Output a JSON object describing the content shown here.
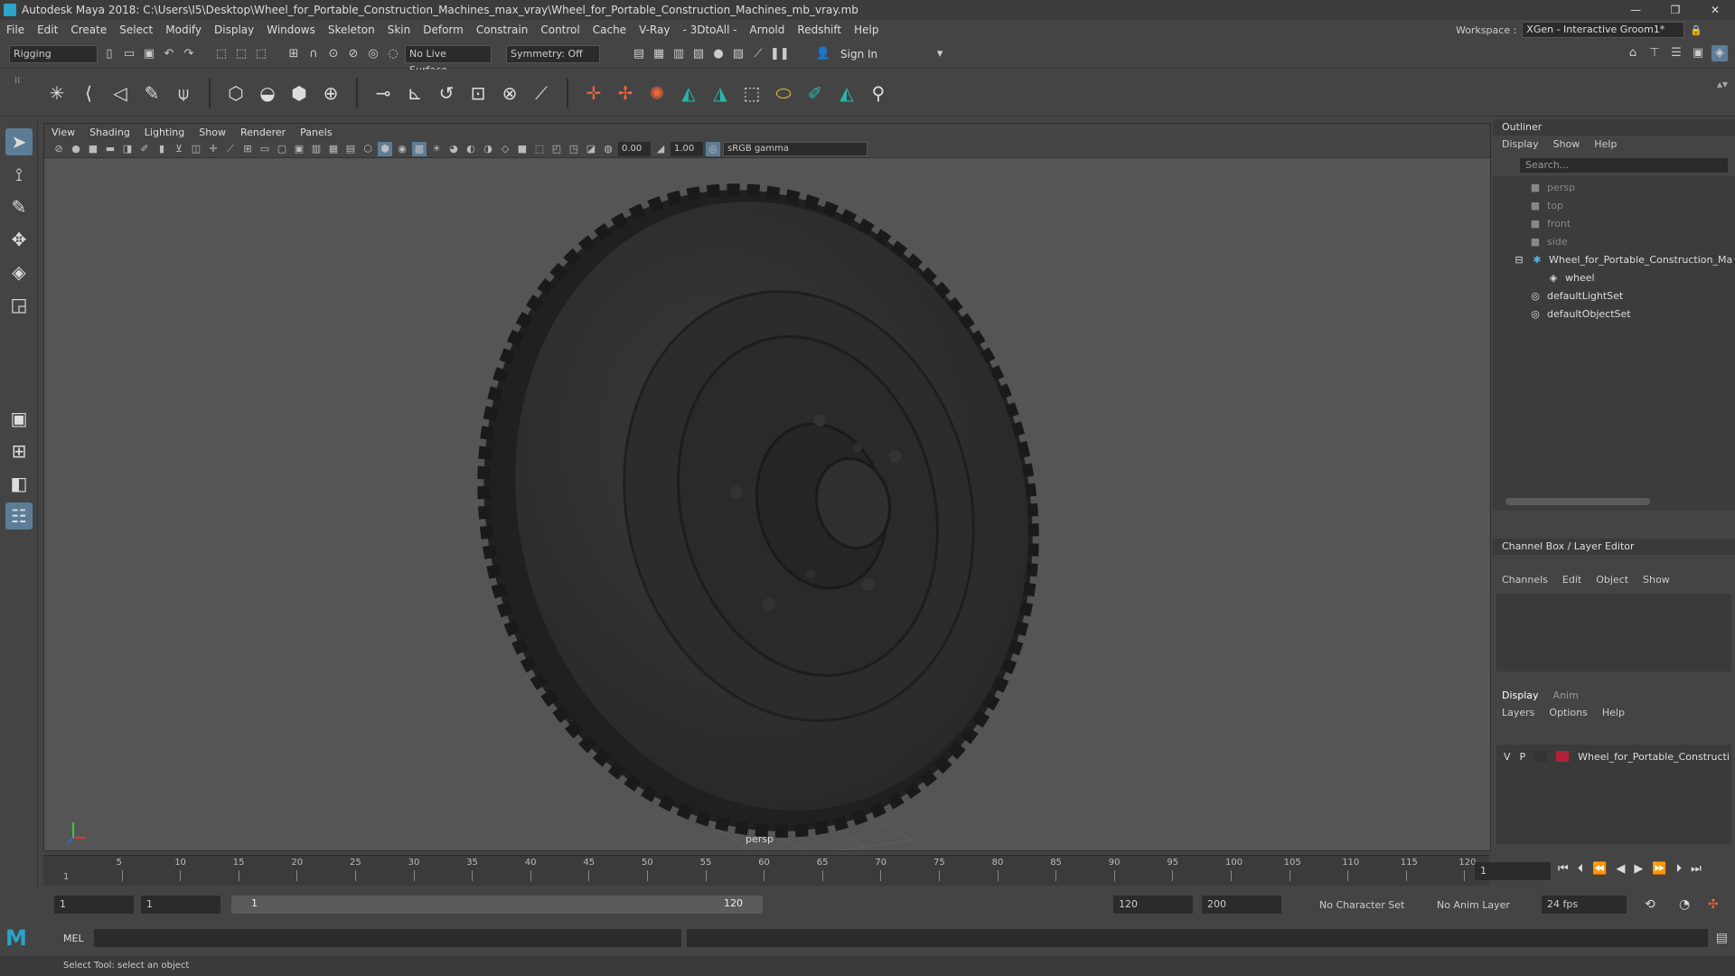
{
  "title": "Autodesk Maya 2018: C:\\Users\\I5\\Desktop\\Wheel_for_Portable_Construction_Machines_max_vray\\Wheel_for_Portable_Construction_Machines_mb_vray.mb",
  "menus": [
    "File",
    "Edit",
    "Create",
    "Select",
    "Modify",
    "Display",
    "Windows",
    "Skeleton",
    "Skin",
    "Deform",
    "Constrain",
    "Control",
    "Cache",
    "V-Ray",
    "- 3DtoAll -",
    "Arnold",
    "Redshift",
    "Help"
  ],
  "workspace": {
    "label": "Workspace :",
    "value": "XGen - Interactive Groom1*"
  },
  "status": {
    "mode": "Rigging",
    "live_surface": "No Live Surface",
    "symmetry": "Symmetry: Off",
    "signin": "Sign In"
  },
  "viewport": {
    "menus": [
      "View",
      "Shading",
      "Lighting",
      "Show",
      "Renderer",
      "Panels"
    ],
    "exposure": "0.00",
    "gamma": "1.00",
    "colorspace": "sRGB gamma",
    "camera": "persp"
  },
  "outliner": {
    "title": "Outliner",
    "menus": [
      "Display",
      "Show",
      "Help"
    ],
    "search_placeholder": "Search...",
    "items": [
      {
        "label": "persp",
        "icon": "camera-icon",
        "dim": true
      },
      {
        "label": "top",
        "icon": "camera-icon",
        "dim": true
      },
      {
        "label": "front",
        "icon": "camera-icon",
        "dim": true
      },
      {
        "label": "side",
        "icon": "camera-icon",
        "dim": true
      },
      {
        "label": "Wheel_for_Portable_Construction_Ma",
        "icon": "group-icon",
        "dim": false
      },
      {
        "label": "wheel",
        "icon": "mesh-icon",
        "dim": false
      },
      {
        "label": "defaultLightSet",
        "icon": "set-icon",
        "dim": false
      },
      {
        "label": "defaultObjectSet",
        "icon": "set-icon",
        "dim": false
      }
    ]
  },
  "channelbox": {
    "title": "Channel Box / Layer Editor",
    "menus": [
      "Channels",
      "Edit",
      "Object",
      "Show"
    ]
  },
  "layers": {
    "tabs": [
      "Display",
      "Anim"
    ],
    "menus": [
      "Layers",
      "Options",
      "Help"
    ],
    "row": {
      "v": "V",
      "p": "P",
      "name": "Wheel_for_Portable_Constructi",
      "color": "#b2213a"
    }
  },
  "timeline": {
    "ticks": [
      "5",
      "10",
      "15",
      "20",
      "25",
      "30",
      "35",
      "40",
      "45",
      "50",
      "55",
      "60",
      "65",
      "70",
      "75",
      "80",
      "85",
      "90",
      "95",
      "100",
      "105",
      "110",
      "115",
      "120"
    ],
    "start_marker": "1",
    "current_frame": "1"
  },
  "range": {
    "start": "1",
    "anim_start": "1",
    "slider_start": "1",
    "slider_end": "120",
    "end": "120",
    "anim_end": "200",
    "char_set": "No Character Set",
    "anim_layer": "No Anim Layer",
    "fps": "24 fps"
  },
  "cmd": {
    "label": "MEL"
  },
  "help": "Select Tool: select an object"
}
